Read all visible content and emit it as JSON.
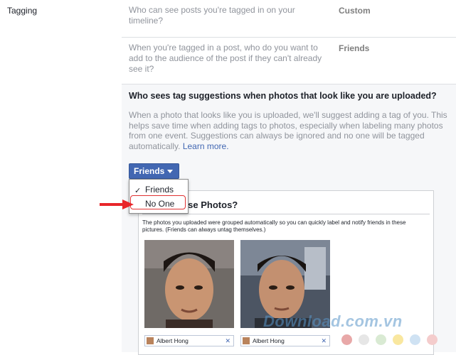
{
  "section": {
    "label": "Tagging"
  },
  "rows": [
    {
      "question": "Who can see posts you're tagged in on your timeline?",
      "value": "Custom"
    },
    {
      "question": "When you're tagged in a post, who do you want to add to the audience of the post if they can't already see it?",
      "value": "Friends"
    }
  ],
  "tag_suggestions": {
    "title": "Who sees tag suggestions when photos that look like you are uploaded?",
    "description": "When a photo that looks like you is uploaded, we'll suggest adding a tag of you. This helps save time when adding tags to photos, especially when labeling many photos from one event. Suggestions can always be ignored and no one will be tagged automatically.",
    "learn_more": "Learn more.",
    "button_label": "Friends"
  },
  "dropdown": {
    "options": [
      {
        "label": "Friends",
        "selected": true
      },
      {
        "label": "No One",
        "selected": false
      }
    ]
  },
  "preview": {
    "title": "hese Photos?",
    "text": "The photos you uploaded were grouped automatically so you can quickly label and notify friends in these pictures. (Friends can always untag themselves.)",
    "tags": [
      {
        "name": "Albert Hong",
        "remove": "✕"
      },
      {
        "name": "Albert Hong",
        "remove": "✕"
      }
    ]
  },
  "watermark": "Download.com.vn",
  "colors": {
    "button": "#4267b2",
    "arrow": "#e8262a",
    "dots": [
      "#e8a8a8",
      "#e6e6e6",
      "#d9ead3",
      "#f9e79f",
      "#cfe2f3",
      "#f4cccc"
    ]
  }
}
